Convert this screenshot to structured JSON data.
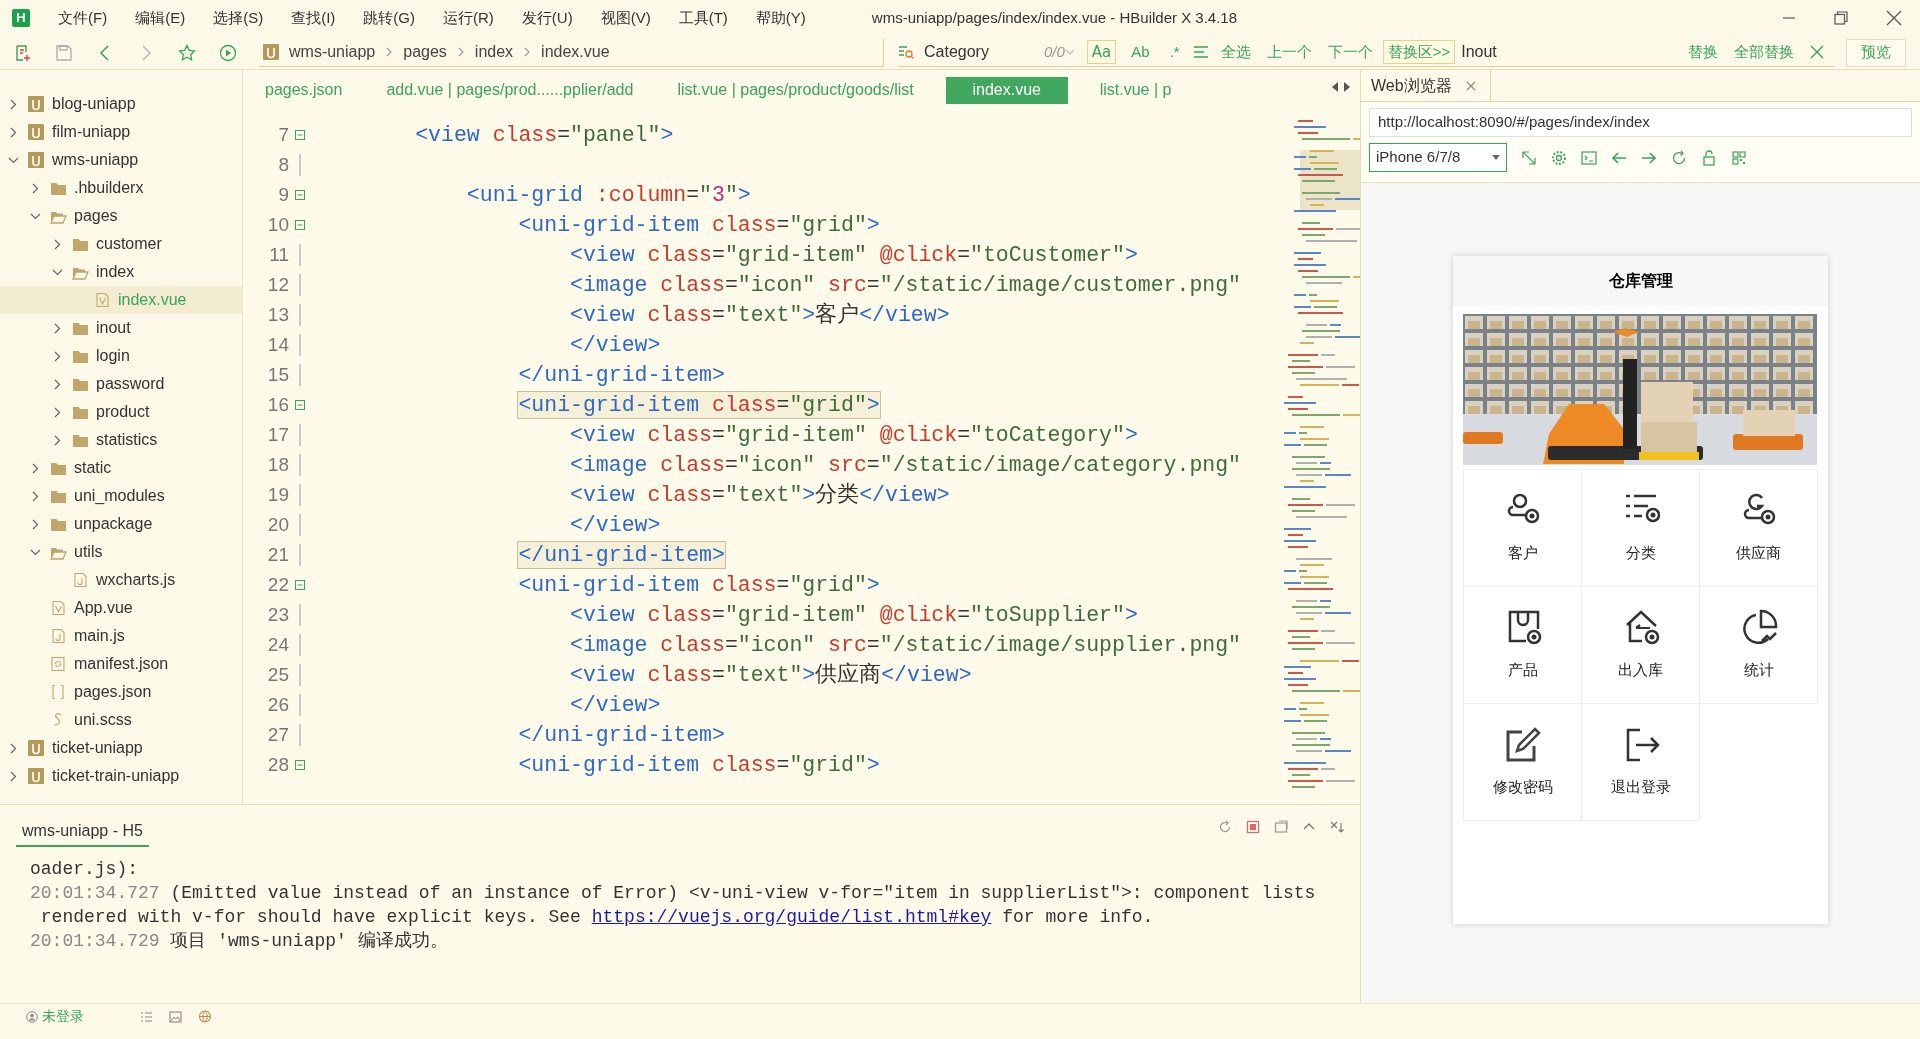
{
  "window": {
    "logo": "H",
    "title": "wms-uniapp/pages/index/index.vue - HBuilder X 3.4.18",
    "menu": [
      "文件(F)",
      "编辑(E)",
      "选择(S)",
      "查找(I)",
      "跳转(G)",
      "运行(R)",
      "发行(U)",
      "视图(V)",
      "工具(T)",
      "帮助(Y)"
    ]
  },
  "toolbar": {
    "breadcrumb": [
      "wms-uniapp",
      "pages",
      "index",
      "index.vue"
    ],
    "find": {
      "value": "Category",
      "count": "0/0",
      "options": [
        {
          "label": "Aa",
          "on": true
        },
        {
          "label": "Ab",
          "on": false
        },
        {
          "label": ".*",
          "on": false
        }
      ],
      "actions": [
        "全选",
        "上一个",
        "下一个"
      ],
      "replace_toggle": "替换区>>",
      "replace_value": "Inout",
      "replace_actions": [
        "替换",
        "全部替换"
      ]
    },
    "preview": "预览"
  },
  "sidebar": {
    "items": [
      {
        "label": "blog-uniapp",
        "kind": "project",
        "expanded": false,
        "selected": false
      },
      {
        "label": "film-uniapp",
        "kind": "project",
        "expanded": false,
        "selected": false
      },
      {
        "label": "wms-uniapp",
        "kind": "project",
        "expanded": true,
        "selected": false,
        "children": [
          {
            "label": ".hbuilderx",
            "kind": "folder",
            "expanded": false,
            "selected": false
          },
          {
            "label": "pages",
            "kind": "folder",
            "expanded": true,
            "selected": false,
            "children": [
              {
                "label": "customer",
                "kind": "folder",
                "expanded": false,
                "selected": false
              },
              {
                "label": "index",
                "kind": "folder",
                "expanded": true,
                "selected": false,
                "children": [
                  {
                    "label": "index.vue",
                    "kind": "vue-file",
                    "selected": true
                  }
                ]
              },
              {
                "label": "inout",
                "kind": "folder",
                "expanded": false,
                "selected": false
              },
              {
                "label": "login",
                "kind": "folder",
                "expanded": false,
                "selected": false
              },
              {
                "label": "password",
                "kind": "folder",
                "expanded": false,
                "selected": false
              },
              {
                "label": "product",
                "kind": "folder",
                "expanded": false,
                "selected": false
              },
              {
                "label": "statistics",
                "kind": "folder",
                "expanded": false,
                "selected": false
              }
            ]
          },
          {
            "label": "static",
            "kind": "folder",
            "expanded": false,
            "selected": false
          },
          {
            "label": "uni_modules",
            "kind": "folder",
            "expanded": false,
            "selected": false
          },
          {
            "label": "unpackage",
            "kind": "folder",
            "expanded": false,
            "selected": false
          },
          {
            "label": "utils",
            "kind": "folder",
            "expanded": true,
            "selected": false,
            "children": [
              {
                "label": "wxcharts.js",
                "kind": "js-file",
                "selected": false
              }
            ]
          },
          {
            "label": "App.vue",
            "kind": "vue-file",
            "selected": false
          },
          {
            "label": "main.js",
            "kind": "js-file",
            "selected": false
          },
          {
            "label": "manifest.json",
            "kind": "manifest-file",
            "selected": false
          },
          {
            "label": "pages.json",
            "kind": "json-file",
            "selected": false
          },
          {
            "label": "uni.scss",
            "kind": "style-file",
            "selected": false
          }
        ]
      },
      {
        "label": "ticket-uniapp",
        "kind": "project",
        "expanded": false,
        "selected": false
      },
      {
        "label": "ticket-train-uniapp",
        "kind": "project",
        "expanded": false,
        "selected": false
      }
    ]
  },
  "editor": {
    "tabs": [
      {
        "label": "pages.json",
        "selected": false
      },
      {
        "label": "add.vue | pages/prod......pplier/add",
        "selected": false
      },
      {
        "label": "list.vue | pages/product/goods/list",
        "selected": false
      },
      {
        "label": "index.vue",
        "selected": true
      },
      {
        "label": "list.vue | p",
        "selected": false
      }
    ],
    "lines": [
      {
        "number": "7",
        "foldable": true,
        "matched": false,
        "tokens": [
          {
            "kind": "tag",
            "text": "        <view"
          },
          {
            "kind": "attr",
            "text": " class"
          },
          {
            "kind": "punct",
            "text": "="
          },
          {
            "kind": "string",
            "text": "\"panel\""
          },
          {
            "kind": "tag",
            "text": ">"
          }
        ]
      },
      {
        "number": "8",
        "foldable": false
      },
      {
        "number": "9",
        "foldable": true,
        "matched": false,
        "tokens": [
          {
            "kind": "tag",
            "text": "            <uni-grid"
          },
          {
            "kind": "attr",
            "text": " :column"
          },
          {
            "kind": "punct",
            "text": "="
          },
          {
            "kind": "string",
            "text": "\""
          },
          {
            "kind": "number",
            "text": "3"
          },
          {
            "kind": "string",
            "text": "\""
          },
          {
            "kind": "tag",
            "text": ">"
          }
        ]
      },
      {
        "number": "10",
        "foldable": true,
        "matched": false,
        "tokens": [
          {
            "kind": "tag",
            "text": "                <uni-grid-item"
          },
          {
            "kind": "attr",
            "text": " class"
          },
          {
            "kind": "punct",
            "text": "="
          },
          {
            "kind": "string",
            "text": "\"grid\""
          },
          {
            "kind": "tag",
            "text": ">"
          }
        ]
      },
      {
        "number": "11",
        "foldable": false,
        "matched": false,
        "tokens": [
          {
            "kind": "tag",
            "text": "                    <view"
          },
          {
            "kind": "attr",
            "text": " class"
          },
          {
            "kind": "punct",
            "text": "="
          },
          {
            "kind": "string",
            "text": "\"grid-item\""
          },
          {
            "kind": "attr",
            "text": " @click"
          },
          {
            "kind": "punct",
            "text": "="
          },
          {
            "kind": "string",
            "text": "\"toCustomer\""
          },
          {
            "kind": "tag",
            "text": ">"
          }
        ]
      },
      {
        "number": "12",
        "foldable": false,
        "matched": false,
        "tokens": [
          {
            "kind": "tag",
            "text": "                    <image"
          },
          {
            "kind": "attr",
            "text": " class"
          },
          {
            "kind": "punct",
            "text": "="
          },
          {
            "kind": "string",
            "text": "\"icon\""
          },
          {
            "kind": "attr",
            "text": " src"
          },
          {
            "kind": "punct",
            "text": "="
          },
          {
            "kind": "string",
            "text": "\"/static/image/customer.png\""
          }
        ]
      },
      {
        "number": "13",
        "foldable": false,
        "matched": false,
        "tokens": [
          {
            "kind": "tag",
            "text": "                    <view"
          },
          {
            "kind": "attr",
            "text": " class"
          },
          {
            "kind": "punct",
            "text": "="
          },
          {
            "kind": "string",
            "text": "\"text\""
          },
          {
            "kind": "tag",
            "text": ">"
          },
          {
            "kind": "text",
            "text": "客户"
          },
          {
            "kind": "tag",
            "text": "</view>"
          }
        ]
      },
      {
        "number": "14",
        "foldable": false,
        "matched": false,
        "tokens": [
          {
            "kind": "tag",
            "text": "                    </view>"
          }
        ]
      },
      {
        "number": "15",
        "foldable": false,
        "matched": false,
        "tokens": [
          {
            "kind": "tag",
            "text": "                </uni-grid-item>"
          }
        ]
      },
      {
        "number": "16",
        "foldable": true,
        "matched": true,
        "tokens": [
          {
            "kind": "tag",
            "text": "                <uni-grid-item"
          },
          {
            "kind": "attr",
            "text": " class"
          },
          {
            "kind": "punct",
            "text": "="
          },
          {
            "kind": "string",
            "text": "\"grid\""
          },
          {
            "kind": "tag",
            "text": ">"
          }
        ]
      },
      {
        "number": "17",
        "foldable": false,
        "matched": false,
        "tokens": [
          {
            "kind": "tag",
            "text": "                    <view"
          },
          {
            "kind": "attr",
            "text": " class"
          },
          {
            "kind": "punct",
            "text": "="
          },
          {
            "kind": "string",
            "text": "\"grid-item\""
          },
          {
            "kind": "attr",
            "text": " @click"
          },
          {
            "kind": "punct",
            "text": "="
          },
          {
            "kind": "string",
            "text": "\"toCategory\""
          },
          {
            "kind": "tag",
            "text": ">"
          }
        ]
      },
      {
        "number": "18",
        "foldable": false,
        "matched": false,
        "tokens": [
          {
            "kind": "tag",
            "text": "                    <image"
          },
          {
            "kind": "attr",
            "text": " class"
          },
          {
            "kind": "punct",
            "text": "="
          },
          {
            "kind": "string",
            "text": "\"icon\""
          },
          {
            "kind": "attr",
            "text": " src"
          },
          {
            "kind": "punct",
            "text": "="
          },
          {
            "kind": "string",
            "text": "\"/static/image/category.png\""
          }
        ]
      },
      {
        "number": "19",
        "foldable": false,
        "matched": false,
        "tokens": [
          {
            "kind": "tag",
            "text": "                    <view"
          },
          {
            "kind": "attr",
            "text": " class"
          },
          {
            "kind": "punct",
            "text": "="
          },
          {
            "kind": "string",
            "text": "\"text\""
          },
          {
            "kind": "tag",
            "text": ">"
          },
          {
            "kind": "text",
            "text": "分类"
          },
          {
            "kind": "tag",
            "text": "</view>"
          }
        ]
      },
      {
        "number": "20",
        "foldable": false,
        "matched": false,
        "tokens": [
          {
            "kind": "tag",
            "text": "                    </view>"
          }
        ]
      },
      {
        "number": "21",
        "foldable": false,
        "matched": true,
        "tokens": [
          {
            "kind": "tag",
            "text": "                </uni-grid-item>"
          }
        ]
      },
      {
        "number": "22",
        "foldable": true,
        "matched": false,
        "tokens": [
          {
            "kind": "tag",
            "text": "                <uni-grid-item"
          },
          {
            "kind": "attr",
            "text": " class"
          },
          {
            "kind": "punct",
            "text": "="
          },
          {
            "kind": "string",
            "text": "\"grid\""
          },
          {
            "kind": "tag",
            "text": ">"
          }
        ]
      },
      {
        "number": "23",
        "foldable": false,
        "matched": false,
        "tokens": [
          {
            "kind": "tag",
            "text": "                    <view"
          },
          {
            "kind": "attr",
            "text": " class"
          },
          {
            "kind": "punct",
            "text": "="
          },
          {
            "kind": "string",
            "text": "\"grid-item\""
          },
          {
            "kind": "attr",
            "text": " @click"
          },
          {
            "kind": "punct",
            "text": "="
          },
          {
            "kind": "string",
            "text": "\"toSupplier\""
          },
          {
            "kind": "tag",
            "text": ">"
          }
        ]
      },
      {
        "number": "24",
        "foldable": false,
        "matched": false,
        "tokens": [
          {
            "kind": "tag",
            "text": "                    <image"
          },
          {
            "kind": "attr",
            "text": " class"
          },
          {
            "kind": "punct",
            "text": "="
          },
          {
            "kind": "string",
            "text": "\"icon\""
          },
          {
            "kind": "attr",
            "text": " src"
          },
          {
            "kind": "punct",
            "text": "="
          },
          {
            "kind": "string",
            "text": "\"/static/image/supplier.png\""
          }
        ]
      },
      {
        "number": "25",
        "foldable": false,
        "matched": false,
        "tokens": [
          {
            "kind": "tag",
            "text": "                    <view"
          },
          {
            "kind": "attr",
            "text": " class"
          },
          {
            "kind": "punct",
            "text": "="
          },
          {
            "kind": "string",
            "text": "\"text\""
          },
          {
            "kind": "tag",
            "text": ">"
          },
          {
            "kind": "text",
            "text": "供应商"
          },
          {
            "kind": "tag",
            "text": "</view>"
          }
        ]
      },
      {
        "number": "26",
        "foldable": false,
        "matched": false,
        "tokens": [
          {
            "kind": "tag",
            "text": "                    </view>"
          }
        ]
      },
      {
        "number": "27",
        "foldable": false,
        "matched": false,
        "tokens": [
          {
            "kind": "tag",
            "text": "                </uni-grid-item>"
          }
        ]
      },
      {
        "number": "28",
        "foldable": true,
        "matched": false,
        "tokens": [
          {
            "kind": "tag",
            "text": "                <uni-grid-item"
          },
          {
            "kind": "attr",
            "text": " class"
          },
          {
            "kind": "punct",
            "text": "="
          },
          {
            "kind": "string",
            "text": "\"grid\""
          },
          {
            "kind": "tag",
            "text": ">"
          }
        ]
      }
    ]
  },
  "console": {
    "tab": "wms-uniapp - H5",
    "lines": [
      {
        "text": "oader.js):"
      },
      {
        "time": "20:01:34.727",
        "text": " (Emitted value instead of an instance of Error) <v-uni-view v-for=\"item in supplierList\">: component lists"
      },
      {
        "text": " rendered with v-for should have explicit keys. See ",
        "link": "https://vuejs.org/guide/list.html#key",
        "after": " for more info."
      },
      {
        "time": "20:01:34.729",
        "text": " 项目 'wms-uniapp' 编译成功。"
      }
    ]
  },
  "status_bar": {
    "user": "未登录"
  },
  "browser": {
    "tab": "Web浏览器",
    "url": "http://localhost:8090/#/pages/index/index",
    "device": "iPhone 6/7/8",
    "phone": {
      "title": "仓库管理",
      "items": [
        "客户",
        "分类",
        "供应商",
        "产品",
        "出入库",
        "统计",
        "修改密码",
        "退出登录"
      ]
    }
  }
}
